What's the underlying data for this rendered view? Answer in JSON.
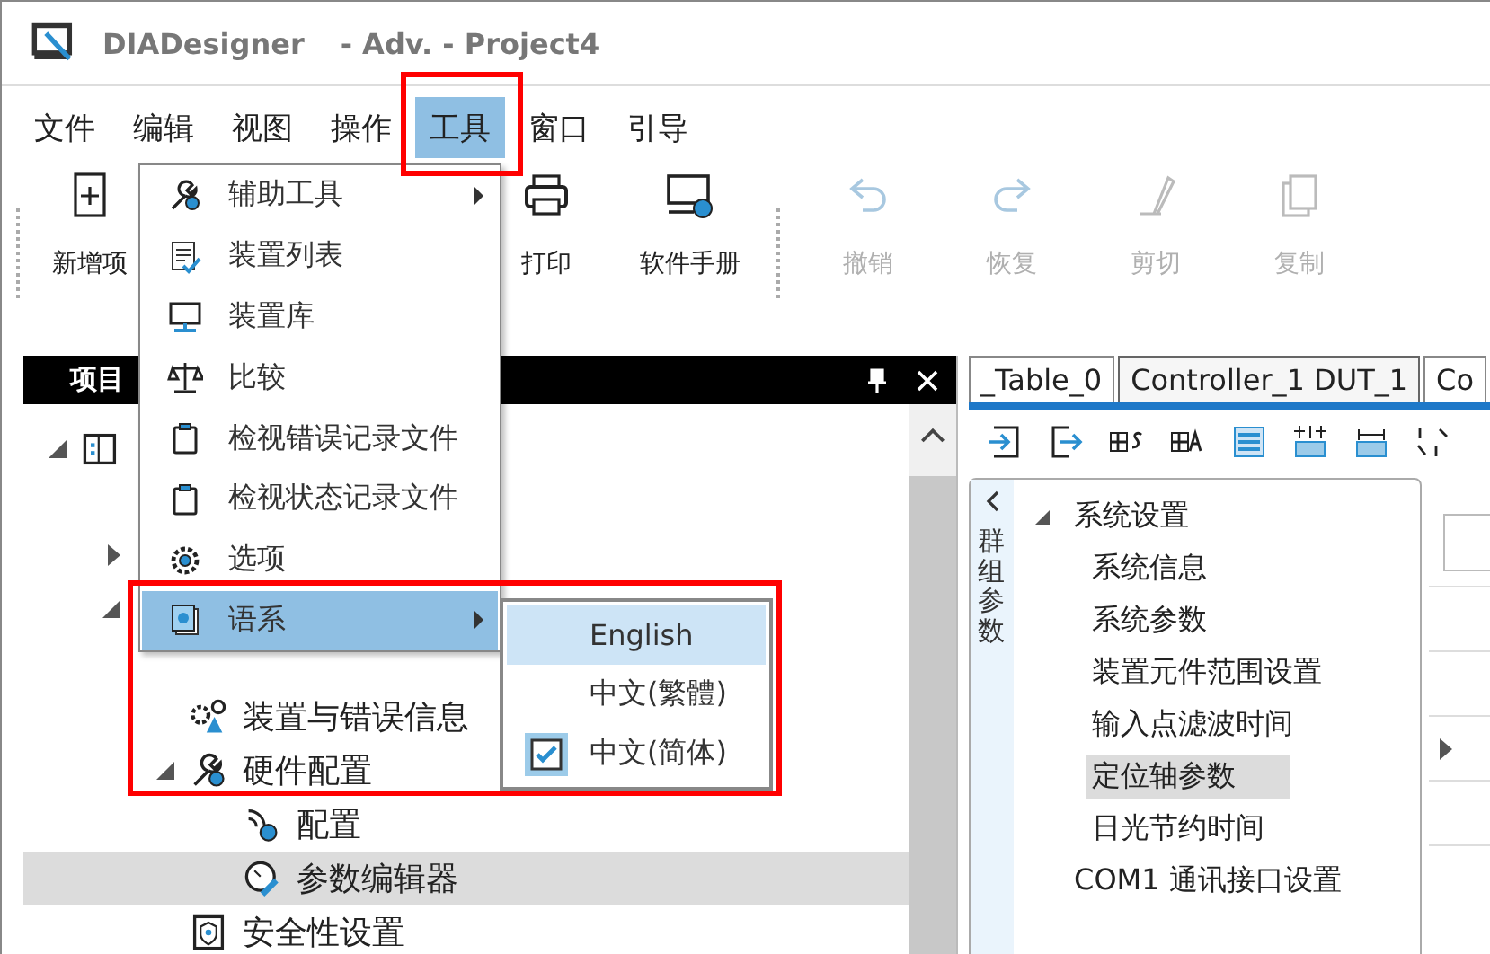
{
  "window": {
    "title": "DIADesigner",
    "subtitle": "- Adv. - Project4"
  },
  "menu_bar": [
    {
      "label": "文件",
      "selected": false
    },
    {
      "label": "编辑",
      "selected": false
    },
    {
      "label": "视图",
      "selected": false
    },
    {
      "label": "操作",
      "selected": false
    },
    {
      "label": "工具",
      "selected": true
    },
    {
      "label": "窗口",
      "selected": false
    },
    {
      "label": "引导",
      "selected": false
    }
  ],
  "toolbar": [
    {
      "label": "新增项",
      "disabled": false
    },
    {
      "label": "打印",
      "disabled": false
    },
    {
      "label": "软件手册",
      "disabled": false
    },
    {
      "label": "撤销",
      "disabled": true
    },
    {
      "label": "恢复",
      "disabled": true
    },
    {
      "label": "剪切",
      "disabled": true
    },
    {
      "label": "复制",
      "disabled": true
    }
  ],
  "tools_menu": [
    {
      "label": "辅助工具",
      "submenu": true,
      "selected": false
    },
    {
      "label": "装置列表",
      "submenu": false,
      "selected": false
    },
    {
      "label": "装置库",
      "submenu": false,
      "selected": false
    },
    {
      "label": "比较",
      "submenu": false,
      "selected": false
    },
    {
      "label": "检视错误记录文件",
      "submenu": false,
      "selected": false
    },
    {
      "label": "检视状态记录文件",
      "submenu": false,
      "selected": false
    },
    {
      "label": "选项",
      "submenu": false,
      "selected": false
    },
    {
      "label": "语系",
      "submenu": true,
      "selected": true
    }
  ],
  "language_menu": [
    {
      "label": "English",
      "selected": true,
      "checked": false
    },
    {
      "label": "中文(繁體)",
      "selected": false,
      "checked": false
    },
    {
      "label": "中文(简体)",
      "selected": false,
      "checked": true
    }
  ],
  "project_panel": {
    "title": "项目",
    "tree": [
      {
        "expanded": true,
        "children": [
          {
            "expanded": false
          },
          {
            "expanded": true,
            "children": [
              {
                "label": "装置与错误信息",
                "selected": false
              },
              {
                "label": "硬件配置",
                "selected": false,
                "expanded": true,
                "children": [
                  {
                    "label": "配置",
                    "selected": false
                  },
                  {
                    "label": "参数编辑器",
                    "selected": true
                  }
                ]
              },
              {
                "label": "安全性设置",
                "selected": false
              }
            ]
          }
        ]
      }
    ]
  },
  "editor_tabs": [
    {
      "label": "_Table_0",
      "selected": false
    },
    {
      "label": "Controller_1 DUT_1",
      "selected": true
    },
    {
      "label": "Co",
      "selected": false
    }
  ],
  "parameter_panel": {
    "side_label": "群组参数",
    "tree": [
      {
        "label": "系统设置",
        "expanded": true,
        "selected": false,
        "children": [
          {
            "label": "系统信息",
            "selected": false
          },
          {
            "label": "系统参数",
            "selected": false
          },
          {
            "label": "装置元件范围设置",
            "selected": false
          },
          {
            "label": "输入点滤波时间",
            "selected": false
          },
          {
            "label": "定位轴参数",
            "selected": true
          },
          {
            "label": "日光节约时间",
            "selected": false
          }
        ]
      },
      {
        "label": "COM1 通讯接口设置",
        "selected": false
      }
    ]
  }
}
